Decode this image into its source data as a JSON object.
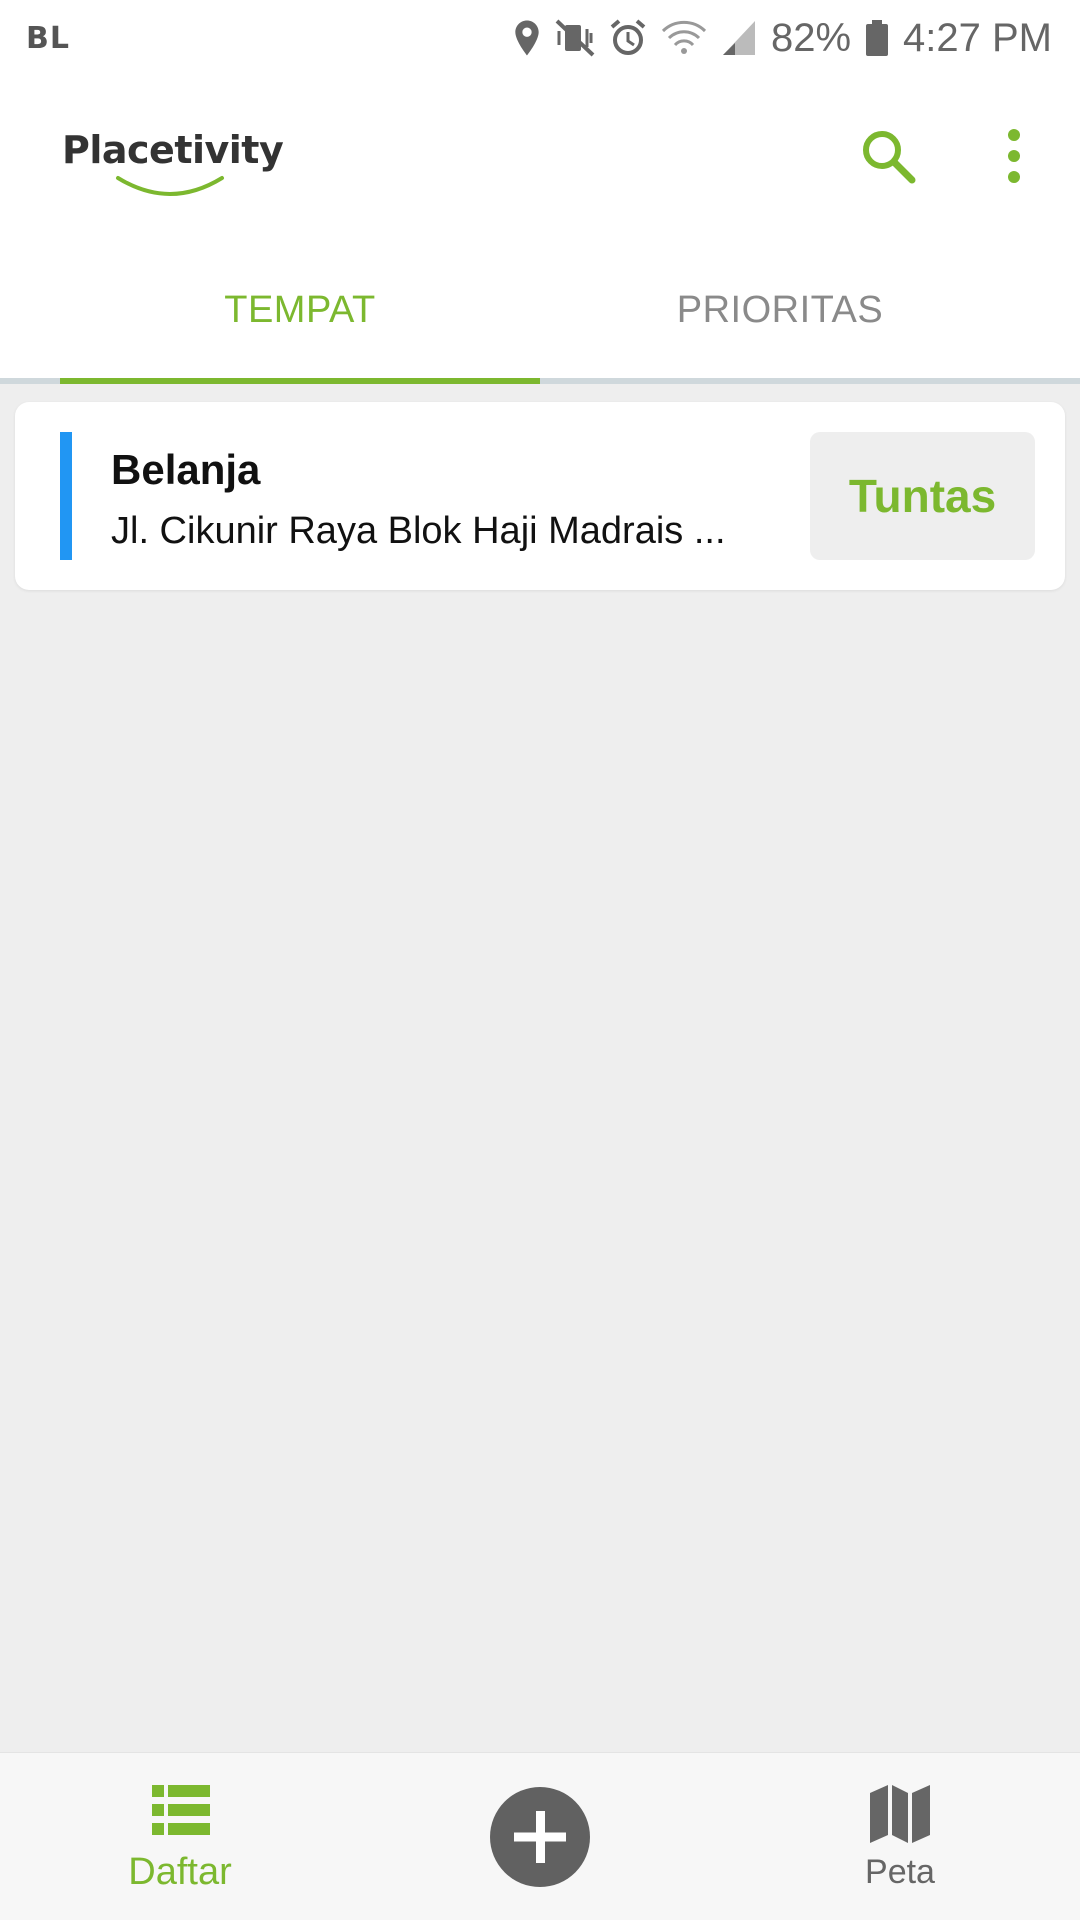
{
  "status_bar": {
    "carrier": "BL",
    "battery": "82%",
    "time": "4:27 PM"
  },
  "app_bar": {
    "logo_text": "Placetivity",
    "icons": [
      "search-icon",
      "more-vert-icon"
    ]
  },
  "tabs": [
    {
      "label": "TEMPAT",
      "active": true
    },
    {
      "label": "PRIORITAS",
      "active": false
    }
  ],
  "list": [
    {
      "title": "Belanja",
      "address": "Jl. Cikunir Raya Blok Haji Madrais ...",
      "action_label": "Tuntas",
      "accent_color": "#2196f3"
    }
  ],
  "bottom_nav": {
    "list_label": "Daftar",
    "map_label": "Peta"
  },
  "colors": {
    "accent": "#7cb82f",
    "inactive": "#8a8a8a",
    "fab": "#616161"
  }
}
